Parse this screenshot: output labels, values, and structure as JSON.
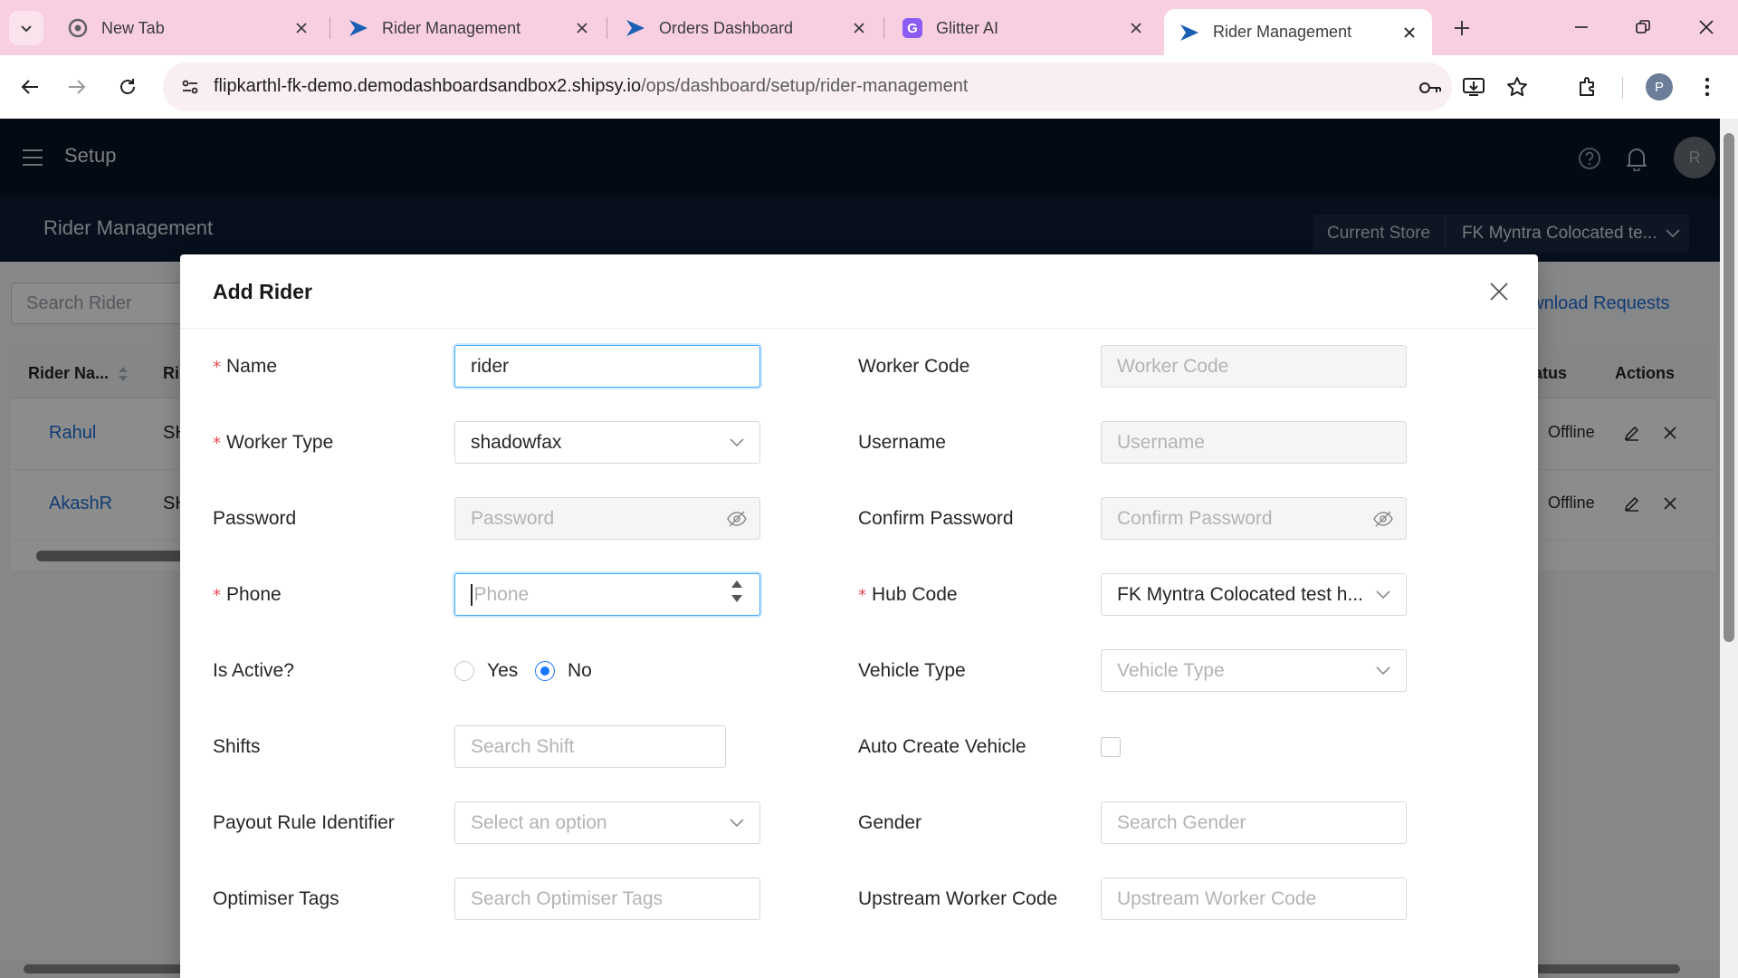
{
  "browser": {
    "tabs": [
      {
        "title": "New Tab",
        "icon": "chrome-icon"
      },
      {
        "title": "Rider Management",
        "icon": "shipsy-icon"
      },
      {
        "title": "Orders Dashboard",
        "icon": "shipsy-icon"
      },
      {
        "title": "Glitter AI",
        "icon": "glitter-icon"
      },
      {
        "title": "Rider Management",
        "icon": "shipsy-icon",
        "active": true
      }
    ],
    "url_host": "flipkarthl-fk-demo.demodashboardsandbox2.shipsy.io",
    "url_path": "/ops/dashboard/setup/rider-management",
    "profile_initial": "P"
  },
  "app": {
    "header_title": "Setup",
    "user_initial": "R",
    "page_title": "Rider Management",
    "store_label": "Current Store",
    "store_value": "FK Myntra Colocated te...",
    "search_placeholder": "Search Rider",
    "download_link": "ownload Requests",
    "table": {
      "headers": {
        "rider_name": "Rider Na...",
        "col2": "Ri",
        "status": "atus",
        "actions": "Actions"
      },
      "rows": [
        {
          "name": "Rahul",
          "col2": "SH",
          "status": "Offline"
        },
        {
          "name": "AkashR",
          "col2": "SH",
          "status": "Offline"
        }
      ]
    }
  },
  "modal": {
    "title": "Add Rider",
    "fields": {
      "name": {
        "label": "Name",
        "value": "rider"
      },
      "worker_code": {
        "label": "Worker Code",
        "placeholder": "Worker Code"
      },
      "worker_type": {
        "label": "Worker Type",
        "value": "shadowfax"
      },
      "username": {
        "label": "Username",
        "placeholder": "Username"
      },
      "password": {
        "label": "Password",
        "placeholder": "Password"
      },
      "confirm_password": {
        "label": "Confirm Password",
        "placeholder": "Confirm Password"
      },
      "phone": {
        "label": "Phone",
        "placeholder": "Phone"
      },
      "hub_code": {
        "label": "Hub Code",
        "value": "FK Myntra Colocated test h..."
      },
      "is_active": {
        "label": "Is Active?",
        "yes": "Yes",
        "no": "No",
        "selected": "No"
      },
      "vehicle_type": {
        "label": "Vehicle Type",
        "placeholder": "Vehicle Type"
      },
      "shifts": {
        "label": "Shifts",
        "placeholder": "Search Shift"
      },
      "auto_create_vehicle": {
        "label": "Auto Create Vehicle",
        "checked": false
      },
      "payout_rule": {
        "label": "Payout Rule Identifier",
        "placeholder": "Select an option"
      },
      "gender": {
        "label": "Gender",
        "placeholder": "Search Gender"
      },
      "optimiser_tags": {
        "label": "Optimiser Tags",
        "placeholder": "Search Optimiser Tags"
      },
      "upstream_worker_code": {
        "label": "Upstream Worker Code",
        "placeholder": "Upstream Worker Code"
      }
    }
  },
  "colors": {
    "accent": "#1677ff",
    "header_bg": "#081323",
    "tab_strip": "#f8cfe1",
    "required": "#e5484d"
  }
}
